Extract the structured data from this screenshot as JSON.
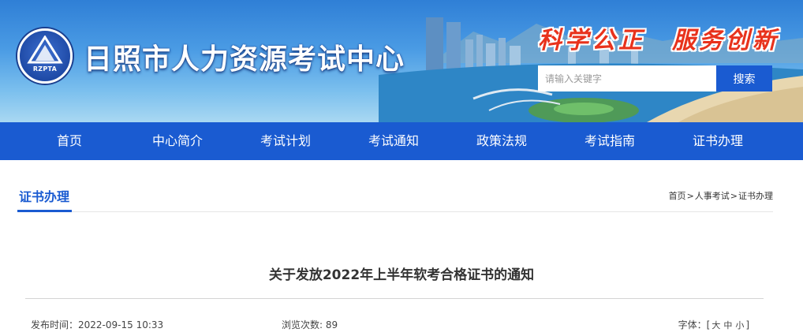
{
  "header": {
    "site_title": "日照市人力资源考试中心",
    "logo_text": "RZPTA",
    "slogan_left": "科学公正",
    "slogan_right": "服务创新",
    "search": {
      "placeholder": "请输入关键字",
      "button_label": "搜索"
    }
  },
  "nav": {
    "items": [
      "首页",
      "中心简介",
      "考试计划",
      "考试通知",
      "政策法规",
      "考试指南",
      "证书办理"
    ]
  },
  "section": {
    "title": "证书办理",
    "breadcrumb": [
      "首页",
      "人事考试",
      "证书办理"
    ],
    "breadcrumb_sep": ">"
  },
  "article": {
    "title": "关于发放2022年上半年软考合格证书的通知",
    "publish_label": "发布时间：",
    "publish_time": "2022-09-15 10:33",
    "views_label": "浏览次数: ",
    "views": "89",
    "font_label": "字体：",
    "font_open": "[",
    "font_close": "]",
    "font_options": [
      "大",
      "中",
      "小"
    ]
  },
  "colors": {
    "primary": "#1a5bd1",
    "slogan": "#e8321c"
  }
}
